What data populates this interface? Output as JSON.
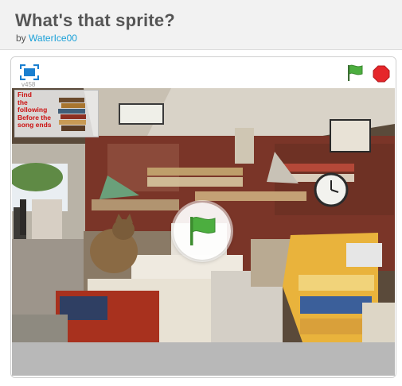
{
  "project": {
    "title": "What's that sprite?",
    "by_label": "by",
    "author": "WaterIce00"
  },
  "player": {
    "version": "v458",
    "sprite_note": [
      "Find",
      "the",
      "following",
      "Before the",
      "song ends"
    ],
    "icons": {
      "fullscreen": "fullscreen-icon",
      "green_flag": "green-flag-icon",
      "stop": "stop-icon",
      "play_overlay": "green-flag-play-icon"
    },
    "colors": {
      "accent": "#1aa0d8",
      "flag_green": "#4cae3f",
      "stop_red": "#e5262a",
      "note_text": "#cc1111"
    }
  }
}
